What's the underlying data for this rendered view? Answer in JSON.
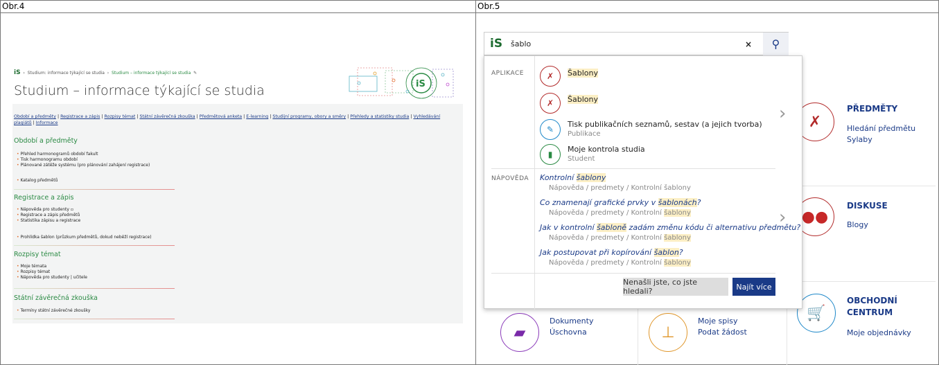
{
  "captions": {
    "left": "Obr.4",
    "right": "Obr.5"
  },
  "left": {
    "breadcrumb": {
      "logo": "iS",
      "part1": "Studium: informace týkající se studia",
      "part2": "Studium – informace týkající se studia"
    },
    "title": "Studium – informace týkající se studia",
    "nav_links": [
      "Období a předměty",
      "Registrace a zápis",
      "Rozpisy témat",
      "Státní závěrečná zkouška",
      "Předmětová anketa",
      "E-learning",
      "Studijní programy, obory a směry",
      "Přehledy a statistiky studia",
      "Vyhledávání plagiátů",
      "Informace"
    ],
    "sections": [
      {
        "title": "Období a předměty",
        "items": [
          "Přehled harmonogramů období fakult",
          "Tisk harmonogramu období",
          "Plánované zátěže systému (pro plánování zahájení registrace)",
          "Katalog předmětů"
        ]
      },
      {
        "title": "Registrace a zápis",
        "items": [
          "Nápověda pro studenty",
          "Registrace a zápis předmětů",
          "Statistika zápisu a registrace",
          "Prohlídka šablon (průzkum předmětů, dokud neběží registrace)"
        ]
      },
      {
        "title": "Rozpisy témat",
        "items": [
          "Moje témata",
          "Rozpisy témat",
          "Nápověda pro studenty | učitele"
        ]
      },
      {
        "title": "Státní závěrečná zkouška",
        "items": [
          "Termíny státní závěrečné zkoušky"
        ]
      }
    ]
  },
  "search": {
    "logo": "iS",
    "value": "šablo",
    "clear": "×",
    "button_icon": "search-icon"
  },
  "dropdown": {
    "apps_label": "APLIKACE",
    "apps": [
      {
        "title": "Šablony",
        "sub": ""
      },
      {
        "title": "Šablony",
        "sub": ""
      },
      {
        "title": "Tisk publikačních seznamů, sestav (a jejich tvorba)",
        "sub": "Publikace"
      },
      {
        "title": "Moje kontrola studia",
        "sub": "Student"
      }
    ],
    "help_label": "NÁPOVĚDA",
    "help": [
      {
        "pre": "Kontrolní ",
        "hl": "šablony",
        "post": "",
        "sub_pre": "Nápověda / predmety / Kontrolní šablony",
        "sub_hl": ""
      },
      {
        "pre": "Co znamenají grafické prvky v ",
        "hl": "šablonách",
        "post": "?",
        "sub_pre": "Nápověda / predmety / Kontrolní ",
        "sub_hl": "šablony"
      },
      {
        "pre": "Jak v kontrolní ",
        "hl": "šabloně",
        "post": " zadám změnu kódu či alternativu předmětu?",
        "sub_pre": "Nápověda / predmety / Kontrolní ",
        "sub_hl": "šablony"
      },
      {
        "pre": "Jak postupovat při kopírování ",
        "hl": "šablon",
        "post": "?",
        "sub_pre": "Nápověda / predmety / Kontrolní ",
        "sub_hl": "šablony"
      }
    ],
    "not_found": "Nenašli jste, co jste hledali?",
    "find_more": "Najít více"
  },
  "tiles": {
    "predmety": {
      "title": "PŘEDMĚTY",
      "links": [
        "Hledání předmětu",
        "Sylaby"
      ]
    },
    "diskuse": {
      "title": "DISKUSE",
      "links": [
        "Blogy"
      ]
    },
    "dokumenty": {
      "links": [
        "Dokumenty",
        "Úschovna"
      ]
    },
    "spisy": {
      "links": [
        "Moje spisy",
        "Podat žádost"
      ]
    },
    "obchodni": {
      "title_line1": "OBCHODNÍ",
      "title_line2": "CENTRUM",
      "links": [
        "Moje objednávky"
      ]
    }
  },
  "colors": {
    "brand_blue": "#1a3a87",
    "green": "#1c6b2f",
    "red": "#b22a2a",
    "highlight": "#fcefc5"
  }
}
